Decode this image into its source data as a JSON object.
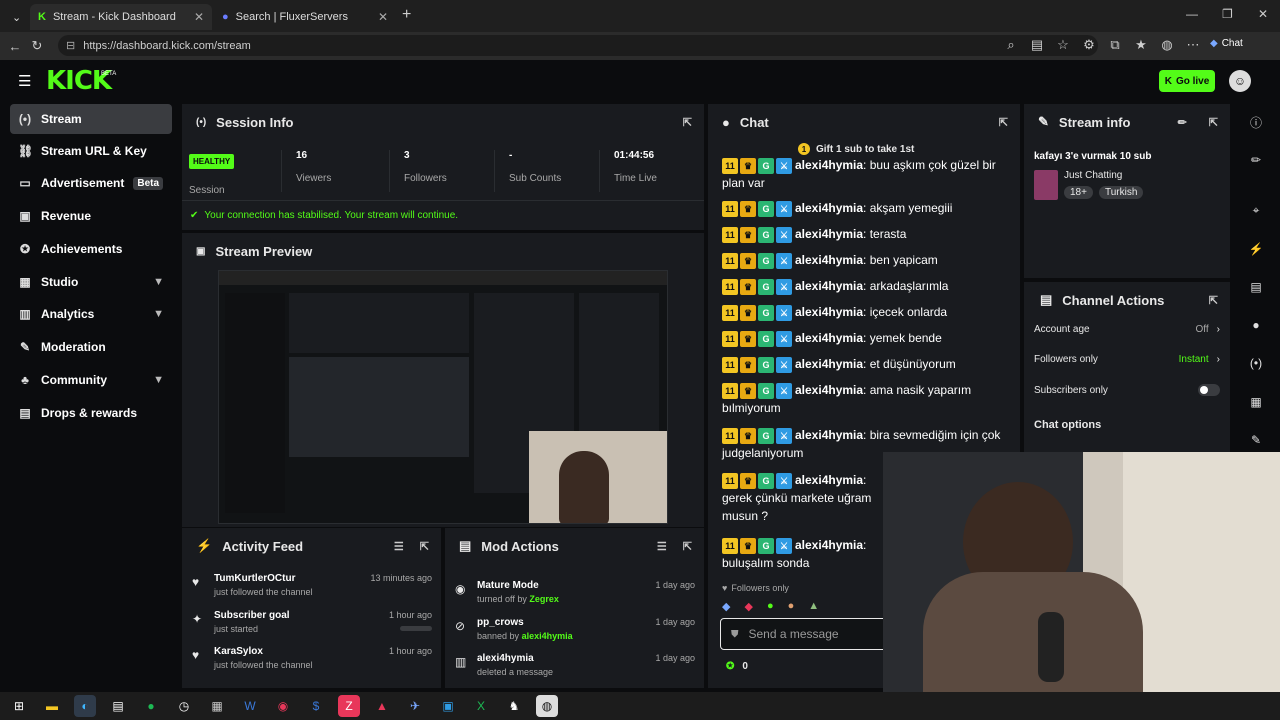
{
  "browser": {
    "tabs": [
      {
        "title": "Stream - Kick Dashboard",
        "active": true
      },
      {
        "title": "Search | FluxerServers",
        "active": false
      }
    ],
    "url": "https://dashboard.kick.com/stream",
    "chat_button": "Chat"
  },
  "header": {
    "logo": "KICK",
    "logo_badge": "BETA",
    "go_live": "Go live"
  },
  "sidebar": {
    "items": [
      {
        "label": "Stream",
        "icon": "radio-waves-icon",
        "selected": true
      },
      {
        "label": "Stream URL & Key",
        "icon": "link-icon"
      },
      {
        "label": "Advertisement",
        "icon": "monitor-icon",
        "badge": "Beta"
      },
      {
        "label": "Revenue",
        "icon": "revenue-icon"
      },
      {
        "label": "Achievements",
        "icon": "badge-icon"
      },
      {
        "label": "Studio",
        "icon": "studio-icon",
        "expandable": true
      },
      {
        "label": "Analytics",
        "icon": "chart-icon",
        "expandable": true
      },
      {
        "label": "Moderation",
        "icon": "wrench-icon"
      },
      {
        "label": "Community",
        "icon": "community-icon",
        "expandable": true
      },
      {
        "label": "Drops & rewards",
        "icon": "gift-icon"
      }
    ]
  },
  "session": {
    "title": "Session Info",
    "status_badge": "HEALTHY",
    "status_label": "Session",
    "viewers": {
      "value": "16",
      "label": "Viewers"
    },
    "followers": {
      "value": "3",
      "label": "Followers"
    },
    "subs": {
      "value": "-",
      "label": "Sub Counts"
    },
    "time": {
      "value": "01:44:56",
      "label": "Time Live"
    },
    "notice": "Your connection has stabilised. Your stream will continue."
  },
  "preview": {
    "title": "Stream Preview"
  },
  "chat": {
    "title": "Chat",
    "gift": "Gift 1 sub to take 1st",
    "messages": [
      {
        "user": "alexi4hymia",
        "text": "buu aşkım çok güzel bir plan var"
      },
      {
        "user": "alexi4hymia",
        "text": "akşam yemegiii"
      },
      {
        "user": "alexi4hymia",
        "text": "terasta"
      },
      {
        "user": "alexi4hymia",
        "text": "ben yapicam"
      },
      {
        "user": "alexi4hymia",
        "text": "arkadaşlarımla"
      },
      {
        "user": "alexi4hymia",
        "text": "içecek onlarda"
      },
      {
        "user": "alexi4hymia",
        "text": "yemek bende"
      },
      {
        "user": "alexi4hymia",
        "text": "et düşünüyorum"
      },
      {
        "user": "alexi4hymia",
        "text": "ama nasik yaparım bılmiyorum"
      },
      {
        "user": "alexi4hymia",
        "text": "bira sevmediğim için çok judgelaniyorum"
      },
      {
        "user": "alexi4hymia",
        "text": "gerek çünkü markete uğram musun ?"
      },
      {
        "user": "alexi4hymia",
        "text": "buluşalım sonda"
      }
    ],
    "followers_only": "Followers only",
    "placeholder": "Send a message",
    "points": "0"
  },
  "stream_info": {
    "title": "Stream info",
    "stream_title": "kafayı 3'e vurmak 10 sub",
    "category": "Just Chatting",
    "tags": [
      "18+",
      "Turkish"
    ]
  },
  "channel_actions": {
    "title": "Channel Actions",
    "rows": [
      {
        "label": "Account age",
        "value": "Off"
      },
      {
        "label": "Followers only",
        "value": "Instant"
      },
      {
        "label": "Subscribers only",
        "value": ""
      }
    ],
    "chat_options": "Chat options"
  },
  "activity": {
    "title": "Activity Feed",
    "items": [
      {
        "title": "TumKurtlerOCtur",
        "sub": "just followed the channel",
        "time": "13 minutes ago"
      },
      {
        "title": "Subscriber goal",
        "sub": "just started",
        "time": "1 hour ago"
      },
      {
        "title": "KaraSylox",
        "sub": "just followed the channel",
        "time": "1 hour ago"
      }
    ]
  },
  "mod_actions": {
    "title": "Mod Actions",
    "items": [
      {
        "title": "Mature Mode",
        "sub_prefix": "turned off by",
        "sub_user": "Zegrex",
        "time": "1 day ago"
      },
      {
        "title": "pp_crows",
        "sub_prefix": "banned by",
        "sub_user": "alexi4hymia",
        "time": "1 day ago"
      },
      {
        "title": "alexi4hymia",
        "sub_prefix": "deleted a message",
        "sub_user": "",
        "time": "1 day ago"
      }
    ]
  },
  "colors": {
    "accent": "#53fc18",
    "panel": "#191b1f",
    "bg": "#0b0c0e"
  }
}
